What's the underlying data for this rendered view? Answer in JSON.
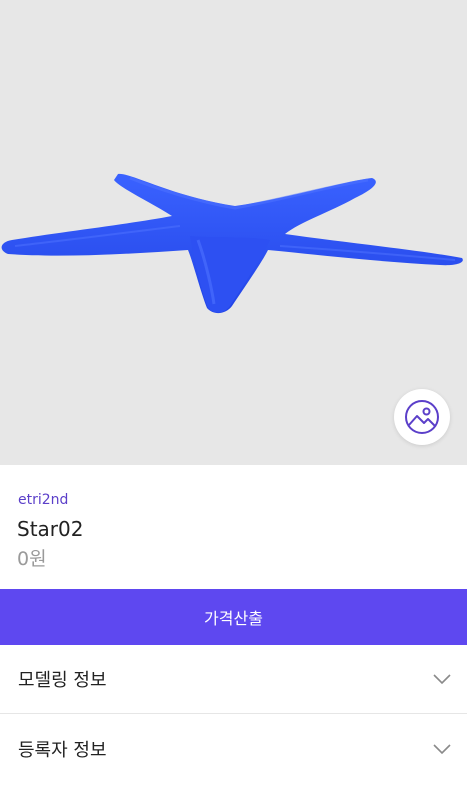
{
  "model": {
    "owner": "etri2nd",
    "title": "Star02",
    "price": "0원"
  },
  "actions": {
    "calc_price_label": "가격산출"
  },
  "sections": [
    {
      "label": "모델링 정보",
      "icon": "chevron-down-icon"
    },
    {
      "label": "등록자 정보",
      "icon": "chevron-down-icon"
    }
  ],
  "viewer": {
    "model_color": "#2f55f7",
    "background": "#e7e7e7",
    "gallery_icon": "image-icon"
  },
  "colors": {
    "accent": "#5e48f0",
    "owner_text": "#5b3fc9"
  }
}
